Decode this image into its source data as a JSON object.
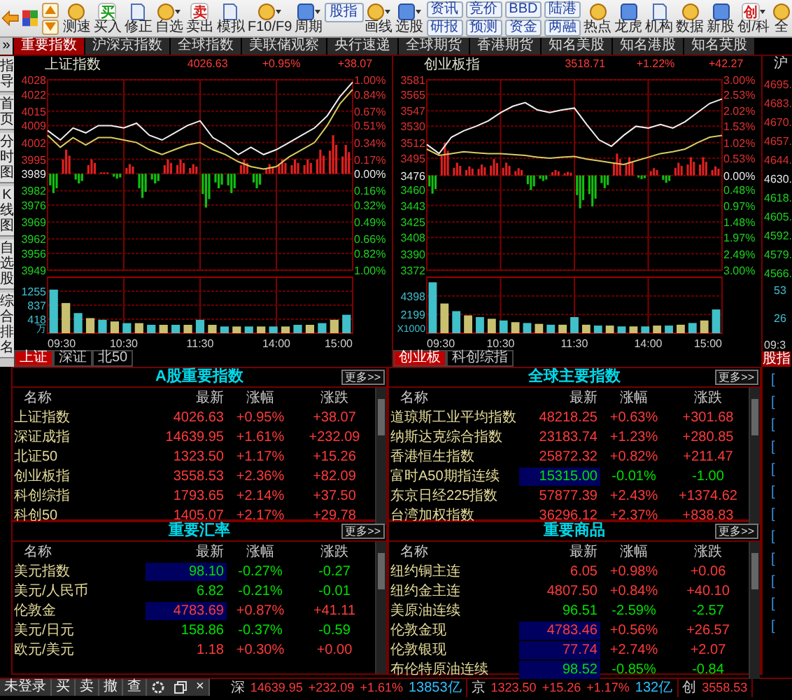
{
  "toolbar": {
    "items": [
      {
        "kind": "back"
      },
      {
        "kind": "grid"
      },
      {
        "kind": "arrows"
      },
      {
        "kind": "tool",
        "label": "测速"
      },
      {
        "kind": "tool",
        "label": "买入",
        "glyph": "买"
      },
      {
        "kind": "tool",
        "label": "修正"
      },
      {
        "kind": "tool",
        "label": "自选",
        "dropdown": true
      },
      {
        "kind": "tool",
        "label": "卖出",
        "glyph": "卖"
      },
      {
        "kind": "tool",
        "label": "模拟"
      },
      {
        "kind": "tool",
        "label": "F10/F9",
        "dropdown": true
      },
      {
        "kind": "tool",
        "label": "周期",
        "dropdown": true
      },
      {
        "kind": "button",
        "label": "股指"
      },
      {
        "kind": "tool",
        "label": "画线",
        "dropdown": true
      },
      {
        "kind": "tool",
        "label": "选股",
        "dropdown": true
      },
      {
        "kind": "pair",
        "labels": [
          "资讯",
          "研报"
        ]
      },
      {
        "kind": "pair",
        "labels": [
          "竞价",
          "预测"
        ]
      },
      {
        "kind": "pair",
        "labels": [
          "BBD",
          "资金"
        ]
      },
      {
        "kind": "pair",
        "labels": [
          "陆港",
          "两融"
        ]
      },
      {
        "kind": "tool",
        "label": "热点"
      },
      {
        "kind": "tool",
        "label": "龙虎"
      },
      {
        "kind": "tool",
        "label": "机构"
      },
      {
        "kind": "tool",
        "label": "数据"
      },
      {
        "kind": "tool",
        "label": "新股"
      },
      {
        "kind": "tool",
        "label": "创/科",
        "glyph": "创",
        "dropdown": true
      },
      {
        "kind": "tool",
        "label": "全"
      }
    ]
  },
  "tabs": {
    "expander": "»",
    "items": [
      {
        "label": "重要指数",
        "selected": true
      },
      {
        "label": "沪深京指数",
        "selected": false
      },
      {
        "label": "全球指数",
        "selected": false
      },
      {
        "label": "美联储观察",
        "selected": false
      },
      {
        "label": "央行速递",
        "selected": false
      },
      {
        "label": "全球期货",
        "selected": false
      },
      {
        "label": "香港期货",
        "selected": false
      },
      {
        "label": "知名美股",
        "selected": false
      },
      {
        "label": "知名港股",
        "selected": false
      },
      {
        "label": "知名英股",
        "selected": false
      }
    ]
  },
  "side_tabs": [
    "指导",
    "首页",
    "分时图",
    "K线图",
    "自选股",
    "综合排名"
  ],
  "panels": [
    {
      "title": "上证指数",
      "price": "4026.63",
      "change_pct": "+0.95%",
      "change": "+38.07",
      "rising": true,
      "price_chart": {
        "pct_labels": [
          "1.00%",
          "0.84%",
          "0.67%",
          "0.51%",
          "0.34%",
          "0.17%",
          "0.00%",
          "0.16%",
          "0.32%",
          "0.49%",
          "0.66%",
          "0.82%",
          "1.00%"
        ],
        "chart_data": {
          "type": "line",
          "ylim": [
            3949,
            4028
          ],
          "yticks": [
            4028,
            4022,
            4015,
            4009,
            4002,
            3995,
            3989,
            3982,
            3976,
            3969,
            3962,
            3956,
            3949
          ],
          "grid": true,
          "series": [
            {
              "color": "#f0f0f0",
              "values": [
                4007,
                4003,
                4008,
                4006,
                4009,
                4009,
                4008,
                4010,
                4005,
                4003,
                4006,
                4009,
                4011,
                4004,
                4001,
                3997,
                4000,
                3997,
                3999,
                4002,
                4005,
                4008,
                4013,
                4021,
                4027
              ]
            },
            {
              "color": "#d8cc60",
              "values": [
                4005,
                4000,
                4004,
                4001,
                4004,
                4004,
                4003,
                4002,
                3999,
                3997,
                3999,
                4001,
                4002,
                3999,
                3997,
                3994,
                3992,
                3991,
                3992,
                3996,
                3999,
                4002,
                4009,
                4018,
                4024
              ]
            }
          ]
        }
      },
      "volume_chart": {
        "chart_data": {
          "type": "bar",
          "ylabel": "万",
          "ylim": [
            0,
            1670
          ],
          "yticks": [
            418,
            837,
            1255
          ],
          "grid": true,
          "values": [
            1300,
            900,
            600,
            450,
            400,
            350,
            300,
            300,
            250,
            250,
            250,
            250,
            400,
            250,
            200,
            200,
            200,
            200,
            200,
            200,
            250,
            250,
            300,
            400,
            550
          ]
        }
      },
      "time_labels": [
        "09:30",
        "10:30",
        "11:30",
        "14:00",
        "15:00"
      ],
      "subtabs": [
        {
          "label": "上证",
          "selected": true
        },
        {
          "label": "深证",
          "selected": false
        },
        {
          "label": "北50",
          "selected": false
        }
      ]
    },
    {
      "title": "创业板指",
      "price": "3518.71",
      "change_pct": "+1.22%",
      "change": "+42.27",
      "rising": true,
      "price_chart": {
        "pct_labels": [
          "3.00%",
          "2.53%",
          "2.02%",
          "1.53%",
          "1.02%",
          "0.53%",
          "0.00%",
          "0.48%",
          "0.97%",
          "1.48%",
          "1.97%",
          "2.49%",
          "3.00%"
        ],
        "chart_data": {
          "type": "line",
          "ylim": [
            3372,
            3581
          ],
          "yticks": [
            3581,
            3565,
            3547,
            3530,
            3512,
            3495,
            3476,
            3460,
            3443,
            3425,
            3408,
            3390,
            3372
          ],
          "grid": true,
          "series": [
            {
              "color": "#f0f0f0",
              "values": [
                3510,
                3500,
                3518,
                3525,
                3530,
                3536,
                3545,
                3552,
                3556,
                3548,
                3545,
                3548,
                3550,
                3532,
                3515,
                3508,
                3520,
                3530,
                3528,
                3532,
                3528,
                3535,
                3545,
                3555,
                3560
              ]
            },
            {
              "color": "#d8cc60",
              "values": [
                3505,
                3498,
                3500,
                3502,
                3501,
                3500,
                3500,
                3499,
                3498,
                3496,
                3495,
                3496,
                3497,
                3494,
                3492,
                3490,
                3488,
                3492,
                3496,
                3500,
                3502,
                3505,
                3512,
                3518,
                3520
              ]
            }
          ]
        }
      },
      "volume_chart": {
        "chart_data": {
          "type": "bar",
          "ylabel": "X1000",
          "ylim": [
            0,
            6600
          ],
          "yticks": [
            2199,
            4398
          ],
          "grid": true,
          "values": [
            6000,
            3500,
            2600,
            2100,
            1900,
            1700,
            1500,
            1300,
            1200,
            1100,
            1000,
            1000,
            1900,
            1000,
            900,
            900,
            800,
            800,
            800,
            900,
            900,
            1000,
            1200,
            1500,
            2800
          ]
        }
      },
      "time_labels": [
        "09:30",
        "10:30",
        "11:30",
        "14:00",
        "15:00"
      ],
      "subtabs": [
        {
          "label": "创业板",
          "selected": true
        },
        {
          "label": "科创综指",
          "selected": false
        }
      ]
    }
  ],
  "partial_panel": {
    "title": "沪",
    "axis": [
      "4695.",
      "4683.",
      "4670.",
      "4657.",
      "4644.",
      "4630.",
      "4618.",
      "4605.",
      "4592.",
      "4579.",
      "4566."
    ],
    "volume_axis": [
      "53",
      "26"
    ],
    "time": "09:3",
    "tab": "股指"
  },
  "tables": [
    {
      "title": "A股重要指数",
      "more": "更多>>",
      "columns": [
        "名称",
        "最新",
        "涨幅",
        "涨跌"
      ],
      "rows": [
        {
          "name": "上证指数",
          "latest": "4026.63",
          "pct": "+0.95%",
          "change": "+38.07",
          "rising": true,
          "highlighted": false
        },
        {
          "name": "深证成指",
          "latest": "14639.95",
          "pct": "+1.61%",
          "change": "+232.09",
          "rising": true,
          "highlighted": false
        },
        {
          "name": "北证50",
          "latest": "1323.50",
          "pct": "+1.17%",
          "change": "+15.26",
          "rising": true,
          "highlighted": false
        },
        {
          "name": "创业板指",
          "latest": "3558.53",
          "pct": "+2.36%",
          "change": "+82.09",
          "rising": true,
          "highlighted": false
        },
        {
          "name": "科创综指",
          "latest": "1793.65",
          "pct": "+2.14%",
          "change": "+37.50",
          "rising": true,
          "highlighted": false
        },
        {
          "name": "科创50",
          "latest": "1405.07",
          "pct": "+2.17%",
          "change": "+29.78",
          "rising": true,
          "highlighted": false
        }
      ]
    },
    {
      "title": "全球主要指数",
      "more": "更多>>",
      "columns": [
        "名称",
        "最新",
        "涨幅",
        "涨跌"
      ],
      "rows": [
        {
          "name": "道琼斯工业平均指数",
          "latest": "48218.25",
          "pct": "+0.63%",
          "change": "+301.68",
          "rising": true,
          "highlighted": false
        },
        {
          "name": "纳斯达克综合指数",
          "latest": "23183.74",
          "pct": "+1.23%",
          "change": "+280.85",
          "rising": true,
          "highlighted": false
        },
        {
          "name": "香港恒生指数",
          "latest": "25872.32",
          "pct": "+0.82%",
          "change": "+211.47",
          "rising": true,
          "highlighted": false
        },
        {
          "name": "富时A50期指连续",
          "latest": "15315.00",
          "pct": "-0.01%",
          "change": "-1.00",
          "rising": false,
          "highlighted": true
        },
        {
          "name": "东京日经225指数",
          "latest": "57877.39",
          "pct": "+2.43%",
          "change": "+1374.62",
          "rising": true,
          "highlighted": false
        },
        {
          "name": "台湾加权指数",
          "latest": "36296.12",
          "pct": "+2.37%",
          "change": "+838.83",
          "rising": true,
          "highlighted": false
        }
      ]
    },
    {
      "title": "重要汇率",
      "more": "更多>>",
      "columns": [
        "名称",
        "最新",
        "涨幅",
        "涨跌"
      ],
      "rows": [
        {
          "name": "美元指数",
          "latest": "98.10",
          "pct": "-0.27%",
          "change": "-0.27",
          "rising": false,
          "highlighted": true
        },
        {
          "name": "美元/人民币",
          "latest": "6.82",
          "pct": "-0.21%",
          "change": "-0.01",
          "rising": false,
          "highlighted": false
        },
        {
          "name": "伦敦金",
          "latest": "4783.69",
          "pct": "+0.87%",
          "change": "+41.11",
          "rising": true,
          "highlighted": true
        },
        {
          "name": "美元/日元",
          "latest": "158.86",
          "pct": "-0.37%",
          "change": "-0.59",
          "rising": false,
          "highlighted": false
        },
        {
          "name": "欧元/美元",
          "latest": "1.18",
          "pct": "+0.30%",
          "change": "+0.00",
          "rising": true,
          "highlighted": false
        }
      ]
    },
    {
      "title": "重要商品",
      "more": "更多>>",
      "columns": [
        "名称",
        "最新",
        "涨幅",
        "涨跌"
      ],
      "rows": [
        {
          "name": "纽约铜主连",
          "latest": "6.05",
          "pct": "+0.98%",
          "change": "+0.06",
          "rising": true,
          "highlighted": false
        },
        {
          "name": "纽约金主连",
          "latest": "4807.50",
          "pct": "+0.84%",
          "change": "+40.10",
          "rising": true,
          "highlighted": false
        },
        {
          "name": "美原油连续",
          "latest": "96.51",
          "pct": "-2.59%",
          "change": "-2.57",
          "rising": false,
          "highlighted": false
        },
        {
          "name": "伦敦金现",
          "latest": "4783.46",
          "pct": "+0.56%",
          "change": "+26.57",
          "rising": true,
          "highlighted": true
        },
        {
          "name": "伦敦银现",
          "latest": "77.74",
          "pct": "+2.74%",
          "change": "+2.07",
          "rising": true,
          "highlighted": true
        },
        {
          "name": "布伦特原油连续",
          "latest": "98.52",
          "pct": "-0.85%",
          "change": "-0.84",
          "rising": false,
          "highlighted": true
        }
      ]
    }
  ],
  "news_strip": [
    "[",
    "[",
    "[",
    "[",
    "[",
    "[",
    "[",
    "[",
    "[",
    "[",
    "[",
    "["
  ],
  "status_bar": {
    "login": "未登录",
    "actions": [
      "买",
      "卖",
      "撤",
      "查"
    ],
    "close": "×",
    "ticker": [
      {
        "market": "深",
        "price": "14639.95",
        "change": "+232.09",
        "pct": "+1.61%",
        "turnover": "13853亿",
        "rising": true
      },
      {
        "market": "京",
        "price": "1323.50",
        "change": "+15.26",
        "pct": "+1.17%",
        "turnover": "132亿",
        "rising": true
      },
      {
        "market": "创",
        "price": "3558.53",
        "rising": true
      }
    ]
  }
}
